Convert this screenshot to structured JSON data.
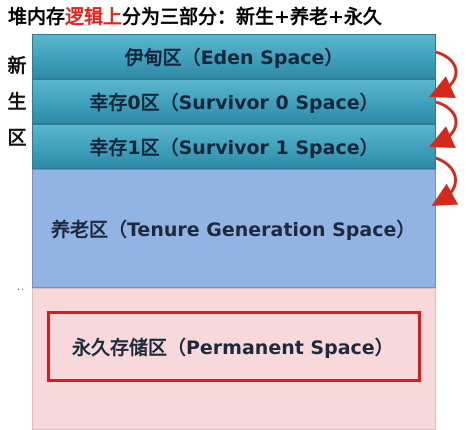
{
  "title": {
    "prefix": "堆内存",
    "highlight": "逻辑上",
    "suffix": "分为三部分：新生+养老+永久"
  },
  "side_label": [
    "新",
    "生",
    "区"
  ],
  "regions": {
    "eden": "伊甸区（Eden Space）",
    "survivor0": "幸存0区（Survivor 0 Space）",
    "survivor1": "幸存1区（Survivor 1 Space）",
    "old": "养老区（Tenure Generation Space）",
    "permanent": "永久存储区（Permanent Space）"
  },
  "dots": "··",
  "colors": {
    "young_gen": "#3fa0bc",
    "old_gen": "#91b4e4",
    "perm_gen": "#f7d9dc",
    "highlight": "#e8221c",
    "arrow": "#d42a1e"
  }
}
